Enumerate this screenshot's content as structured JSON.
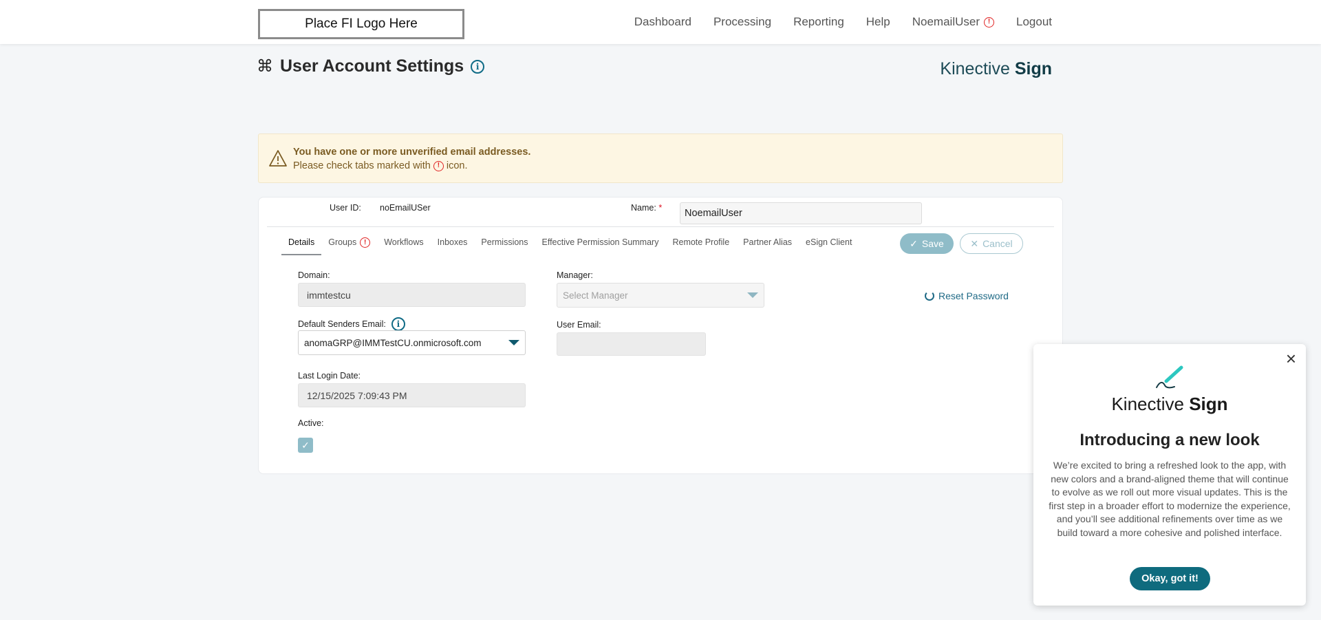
{
  "header": {
    "logo_text": "Place FI Logo Here",
    "nav": [
      {
        "label": "Dashboard"
      },
      {
        "label": "Processing"
      },
      {
        "label": "Reporting"
      },
      {
        "label": "Help"
      },
      {
        "label": "NoemailUser",
        "has_error": true
      },
      {
        "label": "Logout"
      }
    ]
  },
  "page": {
    "title": "User Account Settings",
    "brand_light": "Kinective",
    "brand_bold": "Sign"
  },
  "alert": {
    "line1": "You have one or more unverified email addresses.",
    "line2_prefix": "Please check tabs marked with",
    "line2_suffix": "icon."
  },
  "user": {
    "userid_label": "User ID:",
    "userid_value": "noEmailUSer",
    "name_label": "Name:",
    "name_required": "*",
    "name_value": "NoemailUser"
  },
  "tabs": [
    {
      "label": "Details",
      "active": true
    },
    {
      "label": "Groups",
      "has_error": true
    },
    {
      "label": "Workflows"
    },
    {
      "label": "Inboxes"
    },
    {
      "label": "Permissions"
    },
    {
      "label": "Effective Permission Summary"
    },
    {
      "label": "Remote Profile"
    },
    {
      "label": "Partner Alias"
    },
    {
      "label": "eSign Client"
    }
  ],
  "actions": {
    "save_label": "Save",
    "cancel_label": "Cancel"
  },
  "details": {
    "domain_label": "Domain:",
    "domain_value": "immtestcu",
    "manager_label": "Manager:",
    "manager_placeholder": "Select Manager",
    "reset_password_label": "Reset Password",
    "default_email_label": "Default Senders Email:",
    "default_email_value": "anomaGRP@IMMTestCU.onmicrosoft.com",
    "user_email_label": "User Email:",
    "user_email_value": "",
    "last_login_label": "Last Login Date:",
    "last_login_value": "12/15/2025 7:09:43 PM",
    "active_label": "Active:",
    "active_checked": true
  },
  "popup": {
    "brand_light": "Kinective",
    "brand_bold": "Sign",
    "title": "Introducing a new look",
    "body": "We’re excited to bring a refreshed look to the app, with new colors and a brand-aligned theme that will continue to evolve as we roll out more visual updates. This is the first step in a broader effort to modernize the experience, and you’ll see additional refinements over time as we build toward a more cohesive and polished interface.",
    "button_label": "Okay, got it!"
  },
  "colors": {
    "accent": "#0f6b7e",
    "error": "#e02424",
    "alert_bg": "#fdf6e3",
    "alert_text": "#7a5b22",
    "save_disabled": "#8fbcc8"
  },
  "icons": [
    "command-icon",
    "info-icon",
    "warning-icon",
    "error-icon",
    "check-icon",
    "x-icon",
    "reset-icon",
    "chevron-down-icon",
    "close-icon",
    "pen-icon"
  ]
}
